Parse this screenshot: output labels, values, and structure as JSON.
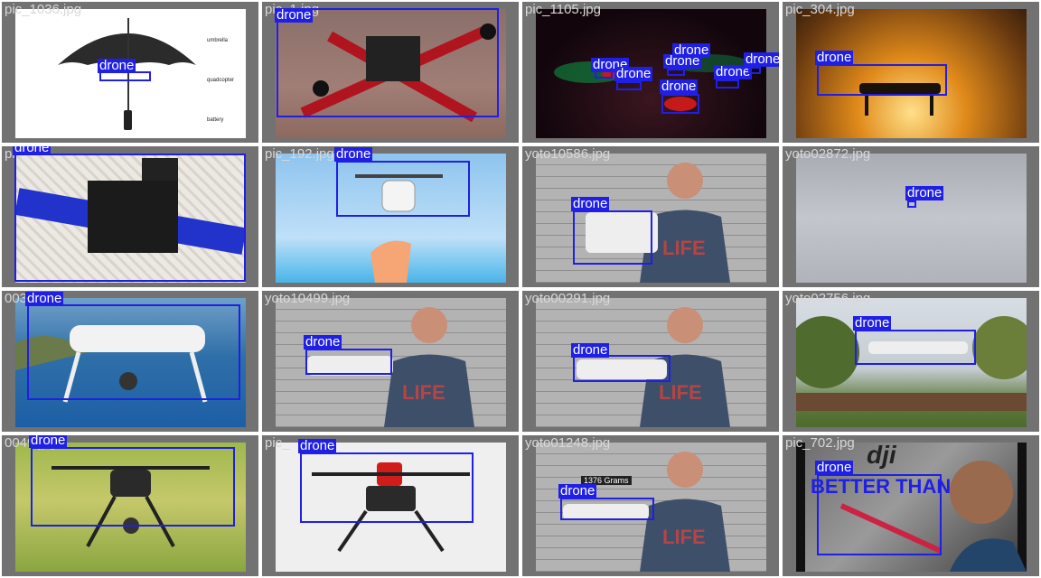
{
  "detection_label": "drone",
  "colors": {
    "box": "#1f1fe6",
    "tile_background": "#727272",
    "grid_gap": "#ffffff"
  },
  "tiles": [
    {
      "filename": "pic_1036.jpg",
      "labels": {
        "umbrella": "umbrella",
        "quadcopter": "quadcopter",
        "battery": "battery"
      }
    },
    {
      "filename": "pic_1.jpg"
    },
    {
      "filename": "pic_1105.jpg"
    },
    {
      "filename": "pic_304.jpg"
    },
    {
      "filename": "pic"
    },
    {
      "filename": "pic_192.jpg"
    },
    {
      "filename": "yoto10586.jpg",
      "shirt": "LIFE"
    },
    {
      "filename": "yoto02872.jpg"
    },
    {
      "filename": "0033.jpg"
    },
    {
      "filename": "yoto10499.jpg",
      "shirt": "LIFE"
    },
    {
      "filename": "yoto00291.jpg",
      "shirt": "LIFE"
    },
    {
      "filename": "yoto02756.jpg"
    },
    {
      "filename": "0049.jpg"
    },
    {
      "filename": "pic_"
    },
    {
      "filename": "yoto01248.jpg",
      "caption": "1376 Grams",
      "shirt": "LIFE"
    },
    {
      "filename": "pic_702.jpg",
      "brand": "dji",
      "caption": "BETTER THAN"
    }
  ]
}
